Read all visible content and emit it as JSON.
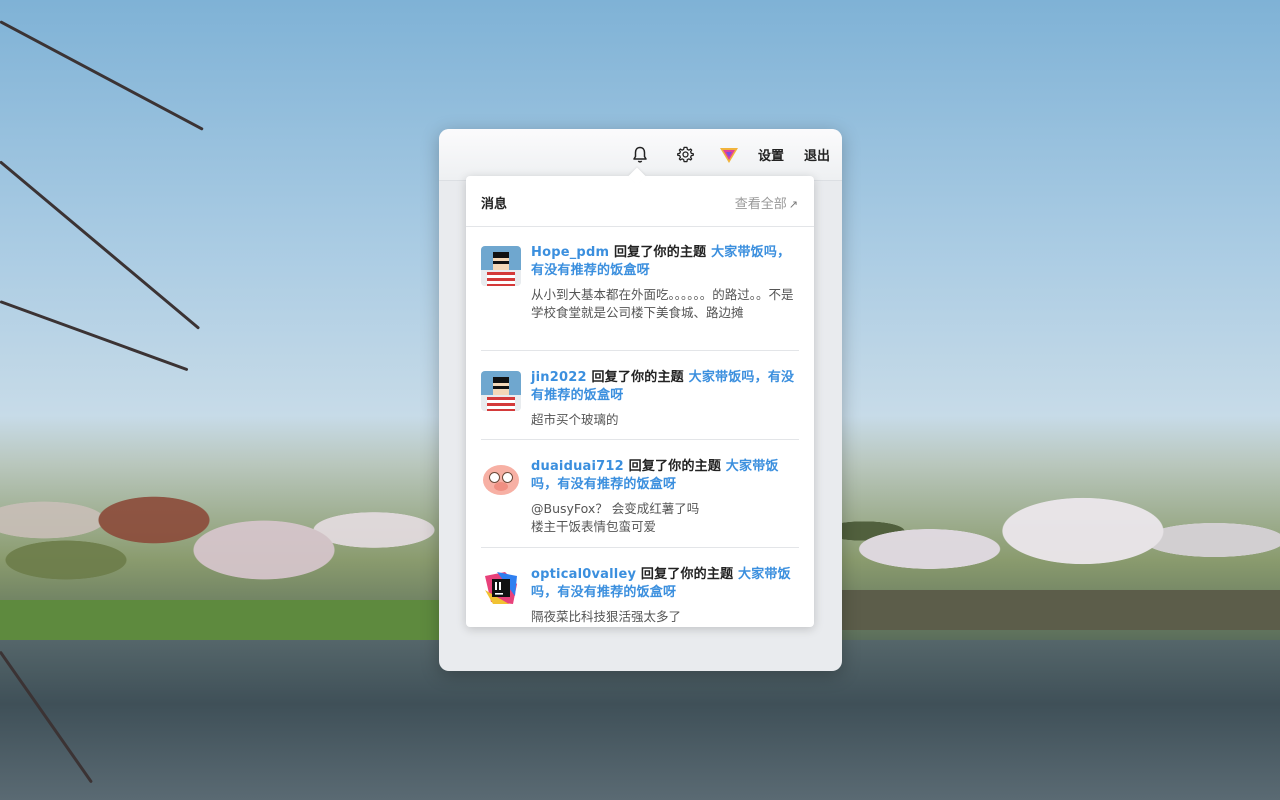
{
  "topbar": {
    "settings_label": "设置",
    "logout_label": "退出",
    "icons": [
      "bell-icon",
      "gear-icon",
      "v-logo-icon"
    ]
  },
  "dropdown": {
    "title": "消息",
    "view_all": "查看全部",
    "view_all_icon": "arrow-up-right-icon"
  },
  "notifications": [
    {
      "user": "Hope_pdm",
      "action": "回复了你的主题",
      "topic": "大家带饭吗，有没有推荐的饭盒呀",
      "content": "从小到大基本都在外面吃。。。。。。的路过。。不是学校食堂就是公司楼下美食城、路边摊",
      "avatar": "pixel-sunglasses-avatar"
    },
    {
      "user": "jin2022",
      "action": "回复了你的主题",
      "topic": "大家带饭吗，有没有推荐的饭盒呀",
      "content": "超市买个玻璃的",
      "avatar": "pixel-sunglasses-avatar"
    },
    {
      "user": "duaiduai712",
      "action": "回复了你的主题",
      "topic": "大家带饭吗，有没有推荐的饭盒呀",
      "content": "@BusyFox？ 会变成红薯了吗",
      "content2": "楼主干饭表情包蛮可爱",
      "avatar": "pig-avatar"
    },
    {
      "user": "optical0valley",
      "action": "回复了你的主题",
      "topic": "大家带饭吗，有没有推荐的饭盒呀",
      "content": "隔夜菜比科技狠活强太多了",
      "avatar": "intellij-avatar"
    }
  ]
}
